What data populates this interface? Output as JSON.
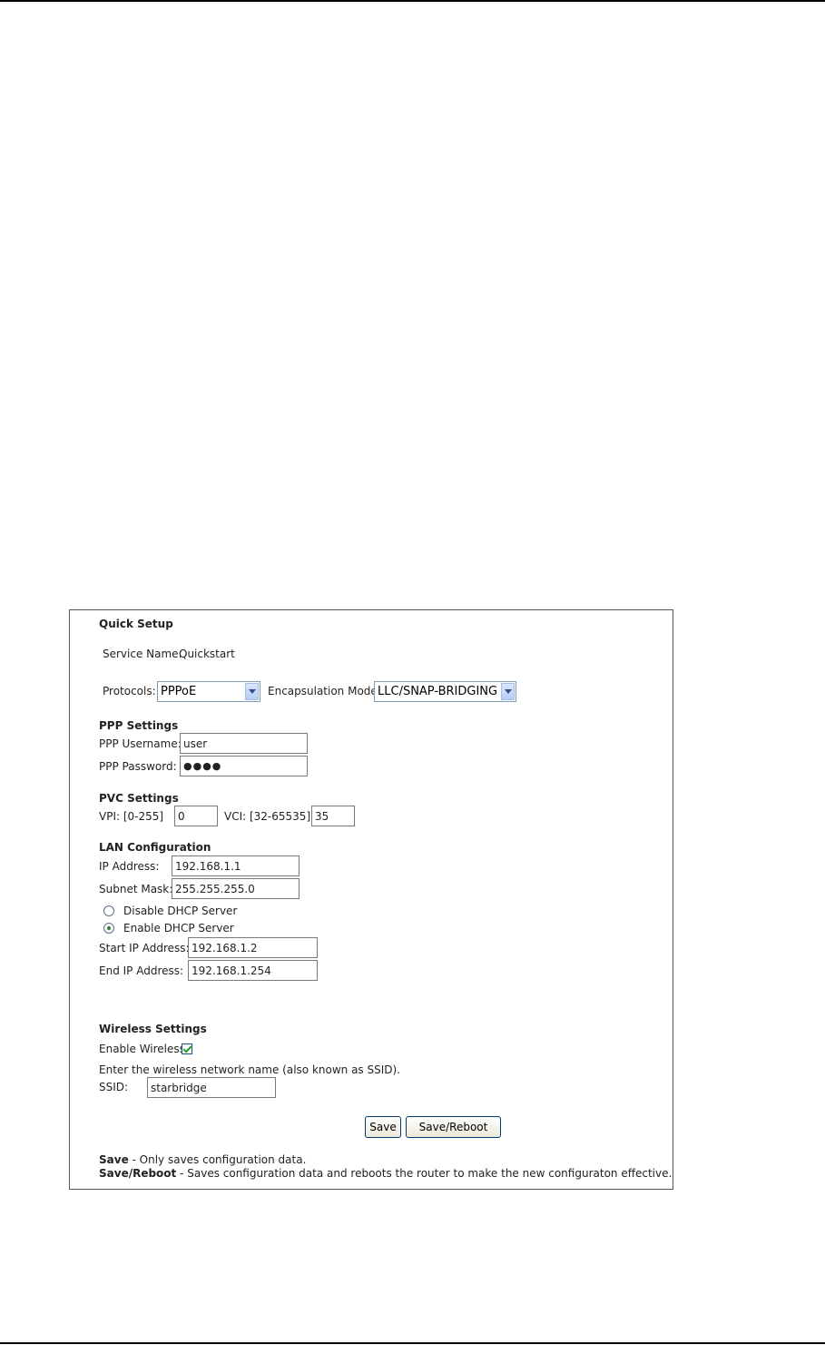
{
  "page": {
    "title": "Quick Setup",
    "service_name_label": "Service Name:",
    "service_name_value": "Quickstart"
  },
  "protocols": {
    "label": "Protocols:",
    "selected": "PPPoE",
    "encapsulation_label": "Encapsulation Mode:",
    "encapsulation_selected": "LLC/SNAP-BRIDGING"
  },
  "ppp": {
    "heading": "PPP Settings",
    "username_label": "PPP Username:",
    "username_value": "user",
    "password_label": "PPP Password:",
    "password_value": "●●●●"
  },
  "pvc": {
    "heading": "PVC Settings",
    "vpi_label": "VPI: [0-255]",
    "vpi_value": "0",
    "vci_label": "VCI: [32-65535]",
    "vci_value": "35"
  },
  "lan": {
    "heading": "LAN Configuration",
    "ip_label": "IP Address:",
    "ip_value": "192.168.1.1",
    "mask_label": "Subnet Mask:",
    "mask_value": "255.255.255.0",
    "disable_dhcp_label": "Disable DHCP Server",
    "enable_dhcp_label": "Enable DHCP Server",
    "dhcp_enabled": true,
    "start_ip_label": "Start IP Address:",
    "start_ip_value": "192.168.1.2",
    "end_ip_label": "End IP Address:",
    "end_ip_value": "192.168.1.254"
  },
  "wireless": {
    "heading": "Wireless Settings",
    "enable_label": "Enable Wireless",
    "enabled": true,
    "ssid_hint": "Enter the wireless network name (also known as SSID).",
    "ssid_label": "SSID:",
    "ssid_value": "starbridge"
  },
  "buttons": {
    "save": "Save",
    "save_reboot": "Save/Reboot"
  },
  "notes": {
    "save_term": "Save",
    "save_desc": " - Only saves configuration data.",
    "save_reboot_term": "Save/Reboot",
    "save_reboot_desc": " - Saves configuration data and reboots the router to make the new configuraton effective."
  }
}
